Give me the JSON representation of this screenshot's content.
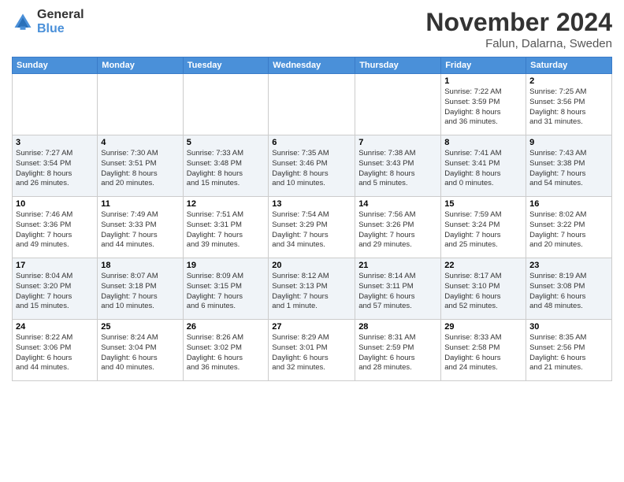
{
  "header": {
    "logo_line1": "General",
    "logo_line2": "Blue",
    "month": "November 2024",
    "location": "Falun, Dalarna, Sweden"
  },
  "weekdays": [
    "Sunday",
    "Monday",
    "Tuesday",
    "Wednesday",
    "Thursday",
    "Friday",
    "Saturday"
  ],
  "weeks": [
    [
      {
        "day": "",
        "info": ""
      },
      {
        "day": "",
        "info": ""
      },
      {
        "day": "",
        "info": ""
      },
      {
        "day": "",
        "info": ""
      },
      {
        "day": "",
        "info": ""
      },
      {
        "day": "1",
        "info": "Sunrise: 7:22 AM\nSunset: 3:59 PM\nDaylight: 8 hours\nand 36 minutes."
      },
      {
        "day": "2",
        "info": "Sunrise: 7:25 AM\nSunset: 3:56 PM\nDaylight: 8 hours\nand 31 minutes."
      }
    ],
    [
      {
        "day": "3",
        "info": "Sunrise: 7:27 AM\nSunset: 3:54 PM\nDaylight: 8 hours\nand 26 minutes."
      },
      {
        "day": "4",
        "info": "Sunrise: 7:30 AM\nSunset: 3:51 PM\nDaylight: 8 hours\nand 20 minutes."
      },
      {
        "day": "5",
        "info": "Sunrise: 7:33 AM\nSunset: 3:48 PM\nDaylight: 8 hours\nand 15 minutes."
      },
      {
        "day": "6",
        "info": "Sunrise: 7:35 AM\nSunset: 3:46 PM\nDaylight: 8 hours\nand 10 minutes."
      },
      {
        "day": "7",
        "info": "Sunrise: 7:38 AM\nSunset: 3:43 PM\nDaylight: 8 hours\nand 5 minutes."
      },
      {
        "day": "8",
        "info": "Sunrise: 7:41 AM\nSunset: 3:41 PM\nDaylight: 8 hours\nand 0 minutes."
      },
      {
        "day": "9",
        "info": "Sunrise: 7:43 AM\nSunset: 3:38 PM\nDaylight: 7 hours\nand 54 minutes."
      }
    ],
    [
      {
        "day": "10",
        "info": "Sunrise: 7:46 AM\nSunset: 3:36 PM\nDaylight: 7 hours\nand 49 minutes."
      },
      {
        "day": "11",
        "info": "Sunrise: 7:49 AM\nSunset: 3:33 PM\nDaylight: 7 hours\nand 44 minutes."
      },
      {
        "day": "12",
        "info": "Sunrise: 7:51 AM\nSunset: 3:31 PM\nDaylight: 7 hours\nand 39 minutes."
      },
      {
        "day": "13",
        "info": "Sunrise: 7:54 AM\nSunset: 3:29 PM\nDaylight: 7 hours\nand 34 minutes."
      },
      {
        "day": "14",
        "info": "Sunrise: 7:56 AM\nSunset: 3:26 PM\nDaylight: 7 hours\nand 29 minutes."
      },
      {
        "day": "15",
        "info": "Sunrise: 7:59 AM\nSunset: 3:24 PM\nDaylight: 7 hours\nand 25 minutes."
      },
      {
        "day": "16",
        "info": "Sunrise: 8:02 AM\nSunset: 3:22 PM\nDaylight: 7 hours\nand 20 minutes."
      }
    ],
    [
      {
        "day": "17",
        "info": "Sunrise: 8:04 AM\nSunset: 3:20 PM\nDaylight: 7 hours\nand 15 minutes."
      },
      {
        "day": "18",
        "info": "Sunrise: 8:07 AM\nSunset: 3:18 PM\nDaylight: 7 hours\nand 10 minutes."
      },
      {
        "day": "19",
        "info": "Sunrise: 8:09 AM\nSunset: 3:15 PM\nDaylight: 7 hours\nand 6 minutes."
      },
      {
        "day": "20",
        "info": "Sunrise: 8:12 AM\nSunset: 3:13 PM\nDaylight: 7 hours\nand 1 minute."
      },
      {
        "day": "21",
        "info": "Sunrise: 8:14 AM\nSunset: 3:11 PM\nDaylight: 6 hours\nand 57 minutes."
      },
      {
        "day": "22",
        "info": "Sunrise: 8:17 AM\nSunset: 3:10 PM\nDaylight: 6 hours\nand 52 minutes."
      },
      {
        "day": "23",
        "info": "Sunrise: 8:19 AM\nSunset: 3:08 PM\nDaylight: 6 hours\nand 48 minutes."
      }
    ],
    [
      {
        "day": "24",
        "info": "Sunrise: 8:22 AM\nSunset: 3:06 PM\nDaylight: 6 hours\nand 44 minutes."
      },
      {
        "day": "25",
        "info": "Sunrise: 8:24 AM\nSunset: 3:04 PM\nDaylight: 6 hours\nand 40 minutes."
      },
      {
        "day": "26",
        "info": "Sunrise: 8:26 AM\nSunset: 3:02 PM\nDaylight: 6 hours\nand 36 minutes."
      },
      {
        "day": "27",
        "info": "Sunrise: 8:29 AM\nSunset: 3:01 PM\nDaylight: 6 hours\nand 32 minutes."
      },
      {
        "day": "28",
        "info": "Sunrise: 8:31 AM\nSunset: 2:59 PM\nDaylight: 6 hours\nand 28 minutes."
      },
      {
        "day": "29",
        "info": "Sunrise: 8:33 AM\nSunset: 2:58 PM\nDaylight: 6 hours\nand 24 minutes."
      },
      {
        "day": "30",
        "info": "Sunrise: 8:35 AM\nSunset: 2:56 PM\nDaylight: 6 hours\nand 21 minutes."
      }
    ]
  ]
}
